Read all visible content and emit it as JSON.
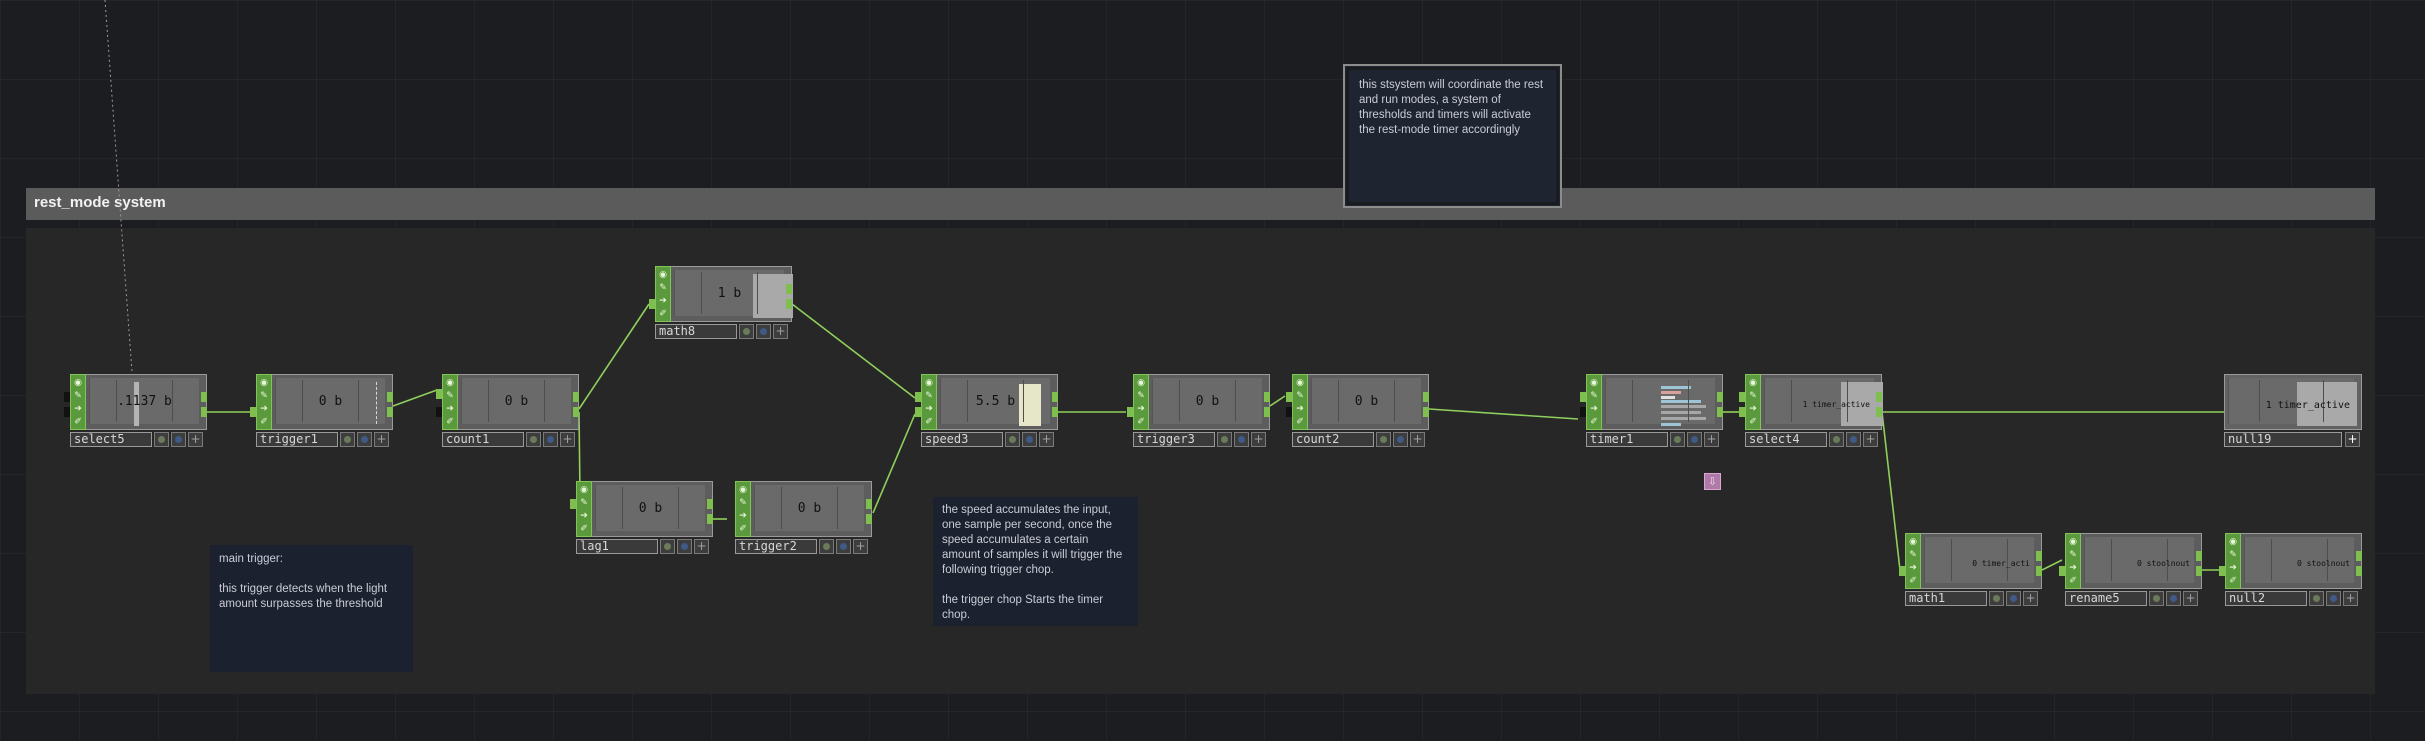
{
  "group": {
    "title": "rest_mode system"
  },
  "comments": {
    "top": "this stsystem will coordinate the rest and run modes, a system of thresholds and timers will activate the rest-mode timer accordingly",
    "main_trigger": "main trigger:\n\nthis trigger detects when the light amount surpasses the threshold",
    "speed": "the speed accumulates the input, one sample per second, once the speed accumulates a certain amount of samples it will trigger the following trigger chop.\n\nthe trigger chop Starts the timer chop."
  },
  "nodes": {
    "select5": {
      "name": "select5",
      "value": ".1137 b"
    },
    "trigger1": {
      "name": "trigger1",
      "value": "0 b"
    },
    "count1": {
      "name": "count1",
      "value": "0 b"
    },
    "math8": {
      "name": "math8",
      "value": "1 b"
    },
    "lag1": {
      "name": "lag1",
      "value": "0 b"
    },
    "trigger2": {
      "name": "trigger2",
      "value": "0 b"
    },
    "speed3": {
      "name": "speed3",
      "value": "5.5 b"
    },
    "trigger3": {
      "name": "trigger3",
      "value": "0 b"
    },
    "count2": {
      "name": "count2",
      "value": "0 b"
    },
    "timer1": {
      "name": "timer1",
      "value": ""
    },
    "select4": {
      "name": "select4",
      "value": "1 timer_active"
    },
    "null19": {
      "name": "null19",
      "value": "1 timer_active"
    },
    "math1": {
      "name": "math1",
      "value": "0 timer_acti"
    },
    "rename5": {
      "name": "rename5",
      "value": "0 stoolnout"
    },
    "null2": {
      "name": "null2",
      "value": "0 stoolnout"
    }
  },
  "icons": {
    "flag_icons": [
      "circle-icon",
      "pencil-icon",
      "arrow-icon",
      "pin-icon"
    ],
    "footer_icons": [
      "bypass-icon",
      "display-icon",
      "plus-icon"
    ],
    "timer_icon": "timer-callback-icon"
  },
  "colors": {
    "wire": "#8fd05c",
    "flag_green": "#5a9a3c",
    "group_header": "#5b5b5b",
    "comment_bg": "#1c2130",
    "speed_bar": "#e6e7c8",
    "timer_badge": "#b07aa8"
  }
}
